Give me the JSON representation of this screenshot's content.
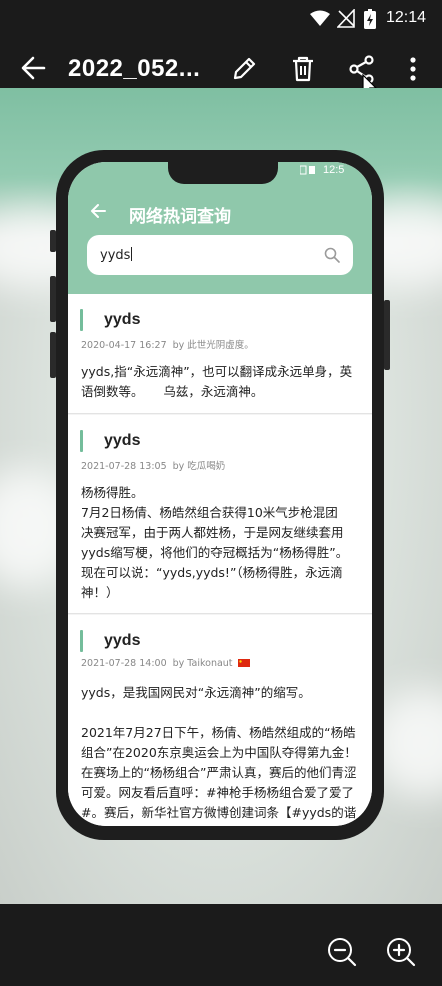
{
  "status_bar": {
    "time": "12:14"
  },
  "viewer": {
    "title": "2022_052..."
  },
  "icons": {
    "back": "arrow-left-icon",
    "edit": "pencil-icon",
    "delete": "trash-icon",
    "share": "share-icon",
    "more": "more-vert-icon",
    "zoom_out": "zoom-out-icon",
    "zoom_in": "zoom-in-icon"
  },
  "app": {
    "status_time": "12:5",
    "title": "网络热词查询",
    "search": {
      "value": "yyds"
    },
    "entries": [
      {
        "word": "yyds",
        "date": "2020-04-17 16:27",
        "author": "by 此世光阴虚度。",
        "lines": [
          "yyds,指“永远滴神”，也可以翻译成永远单身，英",
          "语倒数等。     乌兹，永远滴神。"
        ]
      },
      {
        "word": "yyds",
        "date": "2021-07-28 13:05",
        "author": "by 吃瓜喝奶",
        "lines": [
          "杨杨得胜。",
          "7月2日杨倩、杨皓然组合获得10米气步枪混团",
          "决赛冠军，由于两人都姓杨，于是网友继续套用",
          "yyds缩写梗，将他们的夺冠概括为“杨杨得胜”。",
          "现在可以说：“yyds,yyds!”（杨杨得胜，永远滴",
          "神！）"
        ]
      },
      {
        "word": "yyds",
        "date": "2021-07-28 14:00",
        "author": "by Taikonaut",
        "lines": [
          "yyds，是我国网民对“永远滴神”的缩写。",
          "",
          "2021年7月27日下午，杨倩、杨皓然组成的“杨皓",
          "组合”在2020东京奥运会上为中国队夺得第九金！",
          "在赛场上的“杨杨组合”严肃认真，赛后的他们青涩",
          "可爱。网友看后直呼：#神枪手杨杨组合爱了爱了",
          "#。赛后，新华社官方微博创建词条【#yyds的谐"
        ]
      }
    ]
  }
}
